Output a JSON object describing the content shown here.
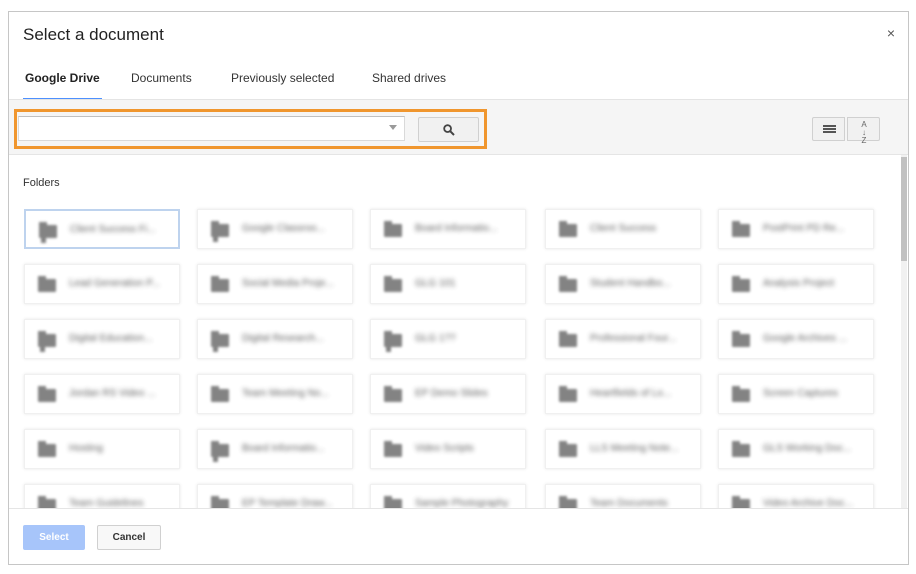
{
  "dialog": {
    "title": "Select a document",
    "close_glyph": "×"
  },
  "tabs": [
    {
      "label": "Google Drive",
      "active": true
    },
    {
      "label": "Documents",
      "active": false
    },
    {
      "label": "Previously selected",
      "active": false
    },
    {
      "label": "Shared drives",
      "active": false
    }
  ],
  "search": {
    "value": "",
    "placeholder": ""
  },
  "toolbar": {
    "search_icon": "search-icon",
    "list_view_icon": "list-view-icon",
    "sort_icon": "sort-az-icon",
    "sort_glyph": "A↓Z"
  },
  "section": {
    "folders_label": "Folders"
  },
  "folders": [
    {
      "name": "Client Success Fi...",
      "shared": true
    },
    {
      "name": "Google Classroo...",
      "shared": true
    },
    {
      "name": "Board Informatio...",
      "shared": false
    },
    {
      "name": "Client Success",
      "shared": false
    },
    {
      "name": "PostPrint PD Re...",
      "shared": false
    },
    {
      "name": "Lead Generation P...",
      "shared": false
    },
    {
      "name": "Social Media Proje...",
      "shared": false
    },
    {
      "name": "GLG 101",
      "shared": false
    },
    {
      "name": "Student Handbo...",
      "shared": false
    },
    {
      "name": "Analysis Project",
      "shared": false
    },
    {
      "name": "Digital Education...",
      "shared": true
    },
    {
      "name": "Digital Research...",
      "shared": true
    },
    {
      "name": "GLG 1??",
      "shared": true
    },
    {
      "name": "Professional Four...",
      "shared": false
    },
    {
      "name": "Google Archives ...",
      "shared": false
    },
    {
      "name": "Jordan RS Video ...",
      "shared": false
    },
    {
      "name": "Team Meeting No...",
      "shared": false
    },
    {
      "name": "EP Demo Slides",
      "shared": false
    },
    {
      "name": "Heartfields of Lo...",
      "shared": false
    },
    {
      "name": "Screen Captures",
      "shared": false
    },
    {
      "name": "Hosting",
      "shared": false
    },
    {
      "name": "Board Informatio...",
      "shared": true
    },
    {
      "name": "Video Scripts",
      "shared": false
    },
    {
      "name": "LLS Meeting Note...",
      "shared": false
    },
    {
      "name": "GLS Working Doc...",
      "shared": false
    },
    {
      "name": "Team Guidelines",
      "shared": false
    },
    {
      "name": "EP Template Draw...",
      "shared": true
    },
    {
      "name": "Sample Photography",
      "shared": false
    },
    {
      "name": "Team Documents",
      "shared": false
    },
    {
      "name": "Video Archive Doc...",
      "shared": false
    }
  ],
  "footer": {
    "select_label": "Select",
    "cancel_label": "Cancel"
  },
  "colors": {
    "accent_tab_underline": "#4d90fe",
    "highlight_outline": "#f0962e",
    "select_button_disabled": "#a7c5fa"
  }
}
